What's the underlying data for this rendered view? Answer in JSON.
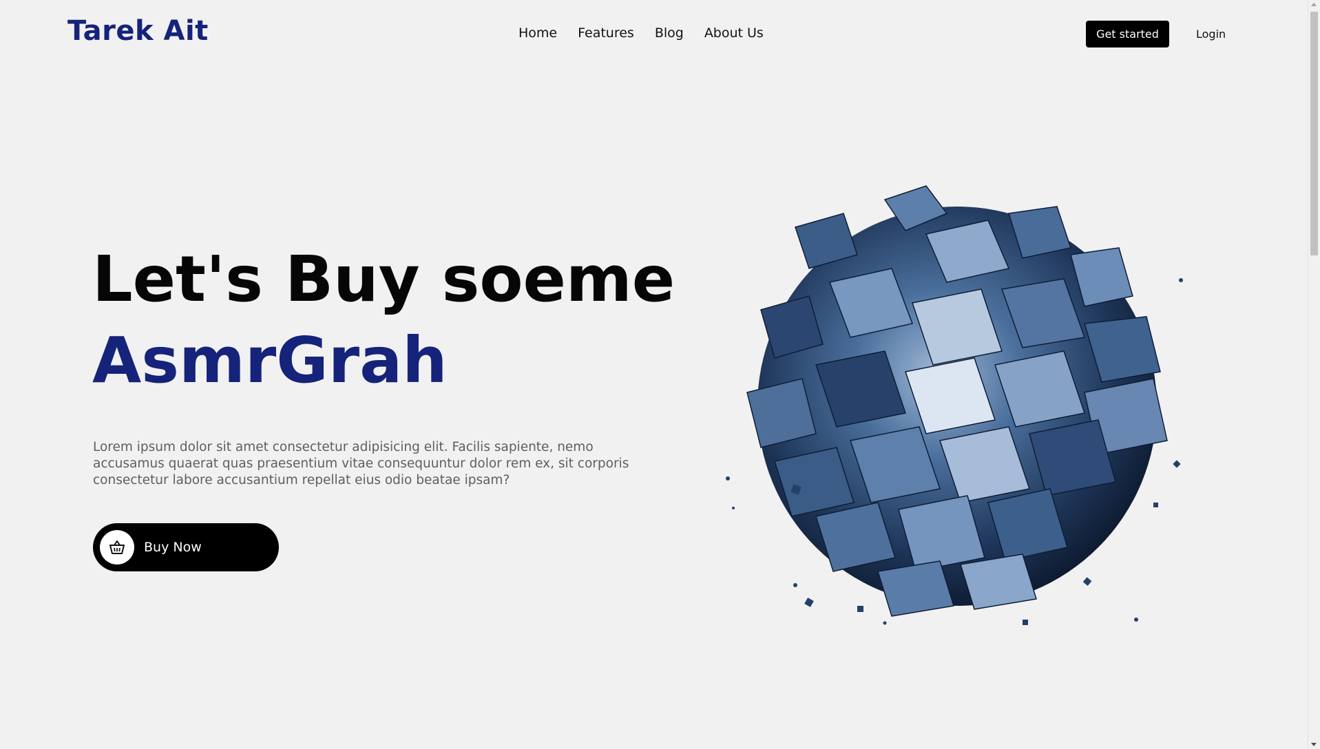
{
  "header": {
    "logo": "Tarek Ait",
    "nav": [
      "Home",
      "Features",
      "Blog",
      "About Us"
    ],
    "get_started": "Get started",
    "login": "Login"
  },
  "hero": {
    "title_line1": "Let's Buy soeme",
    "title_line2": "AsmrGrah",
    "description": "Lorem ipsum dolor sit amet consectetur adipisicing elit. Facilis sapiente, nemo accusamus quaerat quas praesentium vitae consequuntur dolor rem ex, sit corporis consectetur labore accusantium repellat eius odio beatae ipsam?",
    "buy_button": "Buy Now",
    "buy_icon": "basket-icon"
  },
  "illustration": {
    "icon": "abstract-blue-cube-sphere"
  },
  "colors": {
    "brand": "#15237a",
    "background": "#f2f1f1",
    "button": "#000000",
    "text_muted": "#5e5e5e"
  }
}
